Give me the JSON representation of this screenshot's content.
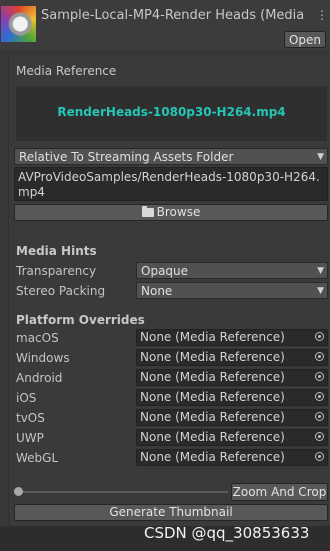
{
  "header": {
    "title": "Sample-Local-MP4-Render Heads (Media",
    "open_label": "Open"
  },
  "media_reference": {
    "section_label": "Media Reference",
    "file_name": "RenderHeads-1080p30-H264.mp4",
    "location": "Relative To Streaming Assets Folder",
    "path": "AVProVideoSamples/RenderHeads-1080p30-H264.mp4",
    "browse_label": "Browse"
  },
  "media_hints": {
    "title": "Media Hints",
    "transparency_label": "Transparency",
    "transparency_value": "Opaque",
    "stereo_label": "Stereo Packing",
    "stereo_value": "None"
  },
  "platform_overrides": {
    "title": "Platform Overrides",
    "items": [
      {
        "label": "macOS",
        "value": "None (Media Reference)"
      },
      {
        "label": "Windows",
        "value": "None (Media Reference)"
      },
      {
        "label": "Android",
        "value": "None (Media Reference)"
      },
      {
        "label": "iOS",
        "value": "None (Media Reference)"
      },
      {
        "label": "tvOS",
        "value": "None (Media Reference)"
      },
      {
        "label": "UWP",
        "value": "None (Media Reference)"
      },
      {
        "label": "WebGL",
        "value": "None (Media Reference)"
      }
    ]
  },
  "thumbnail": {
    "zoom_label": "Zoom And Crop",
    "generate_label": "Generate Thumbnail",
    "slider_value": 0
  },
  "watermark": "CSDN @qq_30853633",
  "icons": {
    "actions": "kebab-menu-icon",
    "browse": "folder-icon",
    "picker": "object-picker-icon",
    "dropdown": "caret-down-icon"
  },
  "colors": {
    "accent_teal": "#24c6b5",
    "panel_bg": "#383838"
  }
}
